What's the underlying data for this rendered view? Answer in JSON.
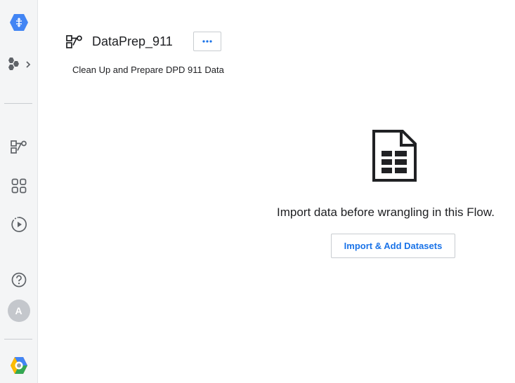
{
  "sidebar": {
    "items": [
      {
        "icon": "dataprep-logo-icon"
      },
      {
        "icon": "services-switcher-icon"
      },
      {
        "icon": "flows-icon"
      },
      {
        "icon": "library-icon"
      },
      {
        "icon": "jobs-icon"
      },
      {
        "icon": "help-icon"
      },
      {
        "icon": "gcp-logo-icon"
      }
    ],
    "avatar_initial": "A"
  },
  "flow": {
    "title": "DataPrep_911",
    "description": "Clean Up and Prepare DPD 911 Data",
    "more_label": "•••"
  },
  "empty_state": {
    "icon": "document-icon",
    "message": "Import data before wrangling in this Flow.",
    "button_label": "Import & Add Datasets"
  },
  "colors": {
    "accent": "#1a73e8",
    "logo_blue": "#4285f4",
    "icon_gray": "#5f6368"
  }
}
